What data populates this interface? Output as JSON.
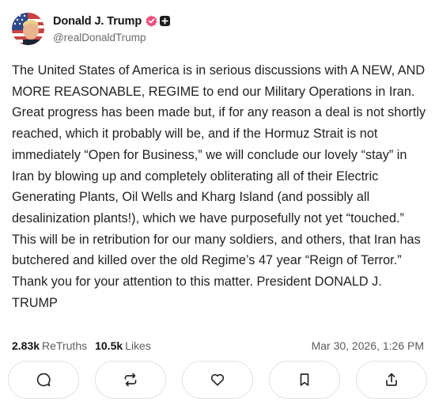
{
  "post": {
    "author": {
      "display_name": "Donald J. Trump",
      "handle": "@realDonaldTrump",
      "avatar_icon": "profile-photo-avatar",
      "verified_icon": "verified-badge-icon",
      "plus_icon": "plus-badge-icon"
    },
    "body": "The United States of America is in serious discussions with A NEW, AND MORE REASONABLE, REGIME to end our Military Operations in Iran. Great progress has been made but, if for any reason a deal is not shortly reached, which it probably will be, and if the Hormuz Strait is not immediately “Open for Business,” we will conclude our lovely “stay” in Iran by blowing up and completely obliterating all of their Electric Generating Plants, Oil Wells and Kharg Island (and possibly all desalinization plants!), which we have purposefully not yet “touched.” This will be in retribution for our many soldiers, and others, that Iran has butchered and killed over the old Regime’s 47 year “Reign of Terror.” Thank you for your attention to this matter. President DONALD J. TRUMP",
    "stats": {
      "retruths_count": "2.83k",
      "retruths_label": "ReTruths",
      "likes_count": "10.5k",
      "likes_label": "Likes"
    },
    "timestamp": "Mar 30, 2026, 1:26 PM",
    "actions": [
      {
        "name": "reply",
        "icon": "comment-bubble-icon"
      },
      {
        "name": "retruth",
        "icon": "repost-arrows-icon"
      },
      {
        "name": "like",
        "icon": "heart-icon"
      },
      {
        "name": "save",
        "icon": "bookmark-icon"
      },
      {
        "name": "share",
        "icon": "share-upload-icon"
      }
    ],
    "colors": {
      "verified": "#ee4f7f",
      "text": "#222222",
      "muted": "#6b6b6b",
      "border": "#e3e3e3"
    }
  }
}
